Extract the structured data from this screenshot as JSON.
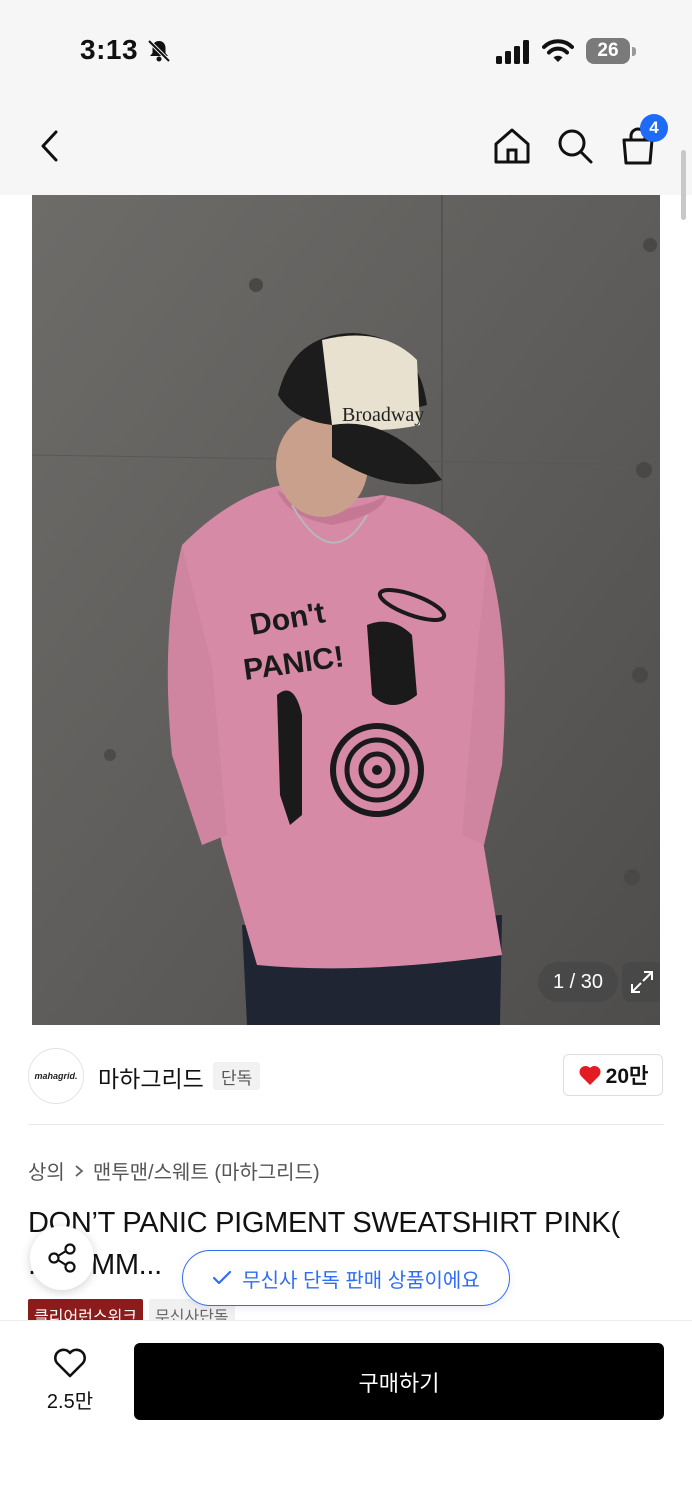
{
  "status_bar": {
    "time": "3:13",
    "battery": "26"
  },
  "header": {
    "cart_count": "4"
  },
  "gallery": {
    "counter": "1 / 30",
    "cap_text": "Broadway",
    "shirt_text_1": "Don't",
    "shirt_text_2": "PANIC!"
  },
  "brand": {
    "logo_text": "mahagrid.",
    "name": "마하그리드",
    "exclusive_label": "단독",
    "likes": "20만"
  },
  "breadcrumb": {
    "items": [
      "상의",
      "맨투맨/스웨트 (마하그리드)"
    ]
  },
  "product": {
    "title": "DON’T PANIC PIGMENT SWEATSHIRT PINK( ...DSMM...",
    "tags": [
      "클리어런스위크",
      "무신사단독"
    ]
  },
  "toast": {
    "text": "무신사 단독 판매 상품이에요"
  },
  "bottom_bar": {
    "wish_count": "2.5만",
    "buy_label": "구매하기"
  },
  "colors": {
    "accent": "#1e6bf5",
    "buy_button": "#000000",
    "heart": "#e31b23",
    "tag_red": "#8c1b1b"
  }
}
